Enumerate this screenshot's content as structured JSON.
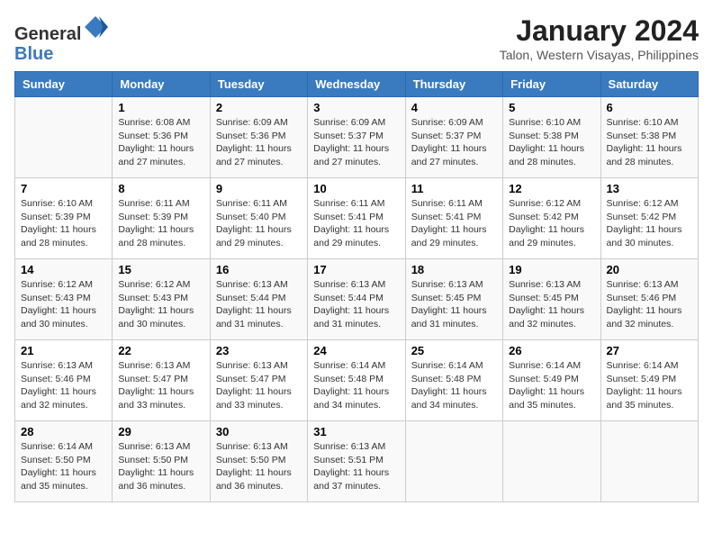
{
  "header": {
    "logo_line1": "General",
    "logo_line2": "Blue",
    "title": "January 2024",
    "subtitle": "Talon, Western Visayas, Philippines"
  },
  "days_of_week": [
    "Sunday",
    "Monday",
    "Tuesday",
    "Wednesday",
    "Thursday",
    "Friday",
    "Saturday"
  ],
  "weeks": [
    [
      {
        "num": "",
        "sunrise": "",
        "sunset": "",
        "daylight": ""
      },
      {
        "num": "1",
        "sunrise": "Sunrise: 6:08 AM",
        "sunset": "Sunset: 5:36 PM",
        "daylight": "Daylight: 11 hours and 27 minutes."
      },
      {
        "num": "2",
        "sunrise": "Sunrise: 6:09 AM",
        "sunset": "Sunset: 5:36 PM",
        "daylight": "Daylight: 11 hours and 27 minutes."
      },
      {
        "num": "3",
        "sunrise": "Sunrise: 6:09 AM",
        "sunset": "Sunset: 5:37 PM",
        "daylight": "Daylight: 11 hours and 27 minutes."
      },
      {
        "num": "4",
        "sunrise": "Sunrise: 6:09 AM",
        "sunset": "Sunset: 5:37 PM",
        "daylight": "Daylight: 11 hours and 27 minutes."
      },
      {
        "num": "5",
        "sunrise": "Sunrise: 6:10 AM",
        "sunset": "Sunset: 5:38 PM",
        "daylight": "Daylight: 11 hours and 28 minutes."
      },
      {
        "num": "6",
        "sunrise": "Sunrise: 6:10 AM",
        "sunset": "Sunset: 5:38 PM",
        "daylight": "Daylight: 11 hours and 28 minutes."
      }
    ],
    [
      {
        "num": "7",
        "sunrise": "Sunrise: 6:10 AM",
        "sunset": "Sunset: 5:39 PM",
        "daylight": "Daylight: 11 hours and 28 minutes."
      },
      {
        "num": "8",
        "sunrise": "Sunrise: 6:11 AM",
        "sunset": "Sunset: 5:39 PM",
        "daylight": "Daylight: 11 hours and 28 minutes."
      },
      {
        "num": "9",
        "sunrise": "Sunrise: 6:11 AM",
        "sunset": "Sunset: 5:40 PM",
        "daylight": "Daylight: 11 hours and 29 minutes."
      },
      {
        "num": "10",
        "sunrise": "Sunrise: 6:11 AM",
        "sunset": "Sunset: 5:41 PM",
        "daylight": "Daylight: 11 hours and 29 minutes."
      },
      {
        "num": "11",
        "sunrise": "Sunrise: 6:11 AM",
        "sunset": "Sunset: 5:41 PM",
        "daylight": "Daylight: 11 hours and 29 minutes."
      },
      {
        "num": "12",
        "sunrise": "Sunrise: 6:12 AM",
        "sunset": "Sunset: 5:42 PM",
        "daylight": "Daylight: 11 hours and 29 minutes."
      },
      {
        "num": "13",
        "sunrise": "Sunrise: 6:12 AM",
        "sunset": "Sunset: 5:42 PM",
        "daylight": "Daylight: 11 hours and 30 minutes."
      }
    ],
    [
      {
        "num": "14",
        "sunrise": "Sunrise: 6:12 AM",
        "sunset": "Sunset: 5:43 PM",
        "daylight": "Daylight: 11 hours and 30 minutes."
      },
      {
        "num": "15",
        "sunrise": "Sunrise: 6:12 AM",
        "sunset": "Sunset: 5:43 PM",
        "daylight": "Daylight: 11 hours and 30 minutes."
      },
      {
        "num": "16",
        "sunrise": "Sunrise: 6:13 AM",
        "sunset": "Sunset: 5:44 PM",
        "daylight": "Daylight: 11 hours and 31 minutes."
      },
      {
        "num": "17",
        "sunrise": "Sunrise: 6:13 AM",
        "sunset": "Sunset: 5:44 PM",
        "daylight": "Daylight: 11 hours and 31 minutes."
      },
      {
        "num": "18",
        "sunrise": "Sunrise: 6:13 AM",
        "sunset": "Sunset: 5:45 PM",
        "daylight": "Daylight: 11 hours and 31 minutes."
      },
      {
        "num": "19",
        "sunrise": "Sunrise: 6:13 AM",
        "sunset": "Sunset: 5:45 PM",
        "daylight": "Daylight: 11 hours and 32 minutes."
      },
      {
        "num": "20",
        "sunrise": "Sunrise: 6:13 AM",
        "sunset": "Sunset: 5:46 PM",
        "daylight": "Daylight: 11 hours and 32 minutes."
      }
    ],
    [
      {
        "num": "21",
        "sunrise": "Sunrise: 6:13 AM",
        "sunset": "Sunset: 5:46 PM",
        "daylight": "Daylight: 11 hours and 32 minutes."
      },
      {
        "num": "22",
        "sunrise": "Sunrise: 6:13 AM",
        "sunset": "Sunset: 5:47 PM",
        "daylight": "Daylight: 11 hours and 33 minutes."
      },
      {
        "num": "23",
        "sunrise": "Sunrise: 6:13 AM",
        "sunset": "Sunset: 5:47 PM",
        "daylight": "Daylight: 11 hours and 33 minutes."
      },
      {
        "num": "24",
        "sunrise": "Sunrise: 6:14 AM",
        "sunset": "Sunset: 5:48 PM",
        "daylight": "Daylight: 11 hours and 34 minutes."
      },
      {
        "num": "25",
        "sunrise": "Sunrise: 6:14 AM",
        "sunset": "Sunset: 5:48 PM",
        "daylight": "Daylight: 11 hours and 34 minutes."
      },
      {
        "num": "26",
        "sunrise": "Sunrise: 6:14 AM",
        "sunset": "Sunset: 5:49 PM",
        "daylight": "Daylight: 11 hours and 35 minutes."
      },
      {
        "num": "27",
        "sunrise": "Sunrise: 6:14 AM",
        "sunset": "Sunset: 5:49 PM",
        "daylight": "Daylight: 11 hours and 35 minutes."
      }
    ],
    [
      {
        "num": "28",
        "sunrise": "Sunrise: 6:14 AM",
        "sunset": "Sunset: 5:50 PM",
        "daylight": "Daylight: 11 hours and 35 minutes."
      },
      {
        "num": "29",
        "sunrise": "Sunrise: 6:13 AM",
        "sunset": "Sunset: 5:50 PM",
        "daylight": "Daylight: 11 hours and 36 minutes."
      },
      {
        "num": "30",
        "sunrise": "Sunrise: 6:13 AM",
        "sunset": "Sunset: 5:50 PM",
        "daylight": "Daylight: 11 hours and 36 minutes."
      },
      {
        "num": "31",
        "sunrise": "Sunrise: 6:13 AM",
        "sunset": "Sunset: 5:51 PM",
        "daylight": "Daylight: 11 hours and 37 minutes."
      },
      {
        "num": "",
        "sunrise": "",
        "sunset": "",
        "daylight": ""
      },
      {
        "num": "",
        "sunrise": "",
        "sunset": "",
        "daylight": ""
      },
      {
        "num": "",
        "sunrise": "",
        "sunset": "",
        "daylight": ""
      }
    ]
  ]
}
